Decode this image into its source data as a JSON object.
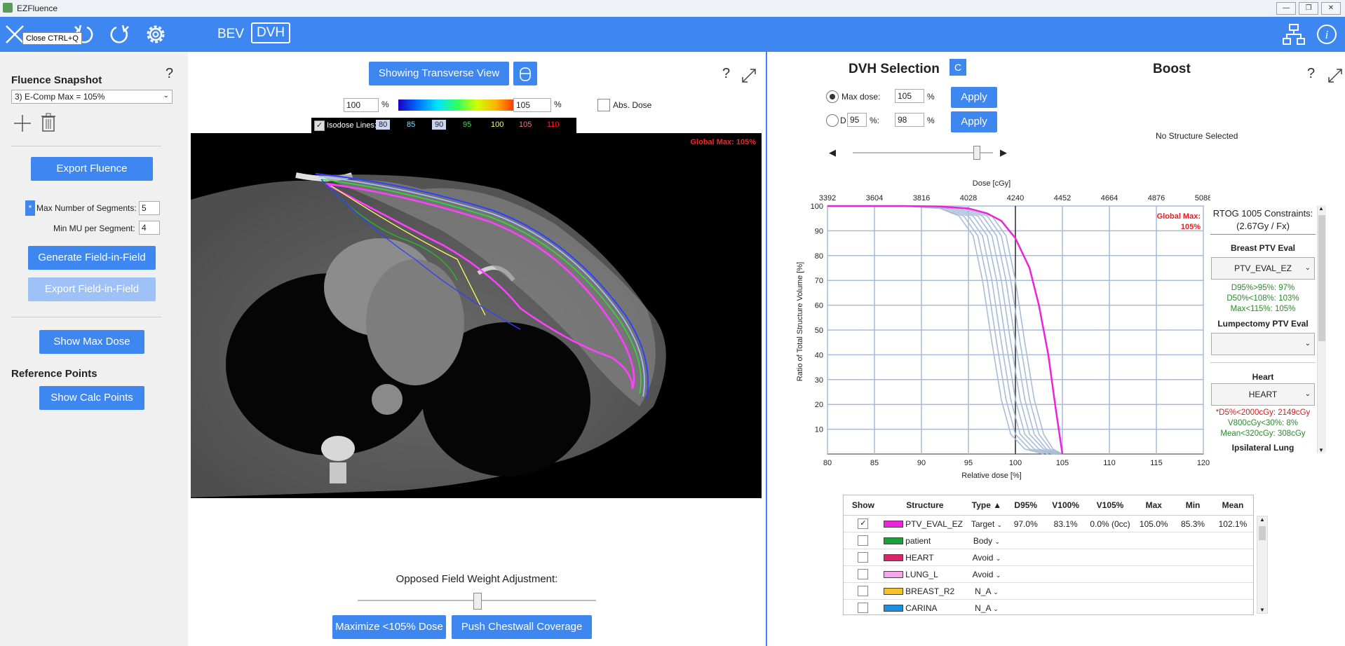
{
  "window": {
    "title": "EZFluence",
    "min": "—",
    "max": "❐",
    "close": "✕"
  },
  "toolbar": {
    "tooltip": "Close CTRL+Q",
    "bev": "BEV",
    "dvh": "DVH"
  },
  "left": {
    "snapshot_title": "Fluence Snapshot",
    "help": "?",
    "snapshot_selected": "3) E-Comp Max = 105%",
    "export_fluence": "Export Fluence",
    "asterisk": "*",
    "max_segments_label": "Max Number of Segments:",
    "max_segments_value": "5",
    "min_mu_label": "Min MU per Segment:",
    "min_mu_value": "4",
    "generate_fif": "Generate Field-in-Field",
    "export_fif": "Export Field-in-Field",
    "show_max_dose": "Show Max Dose",
    "reference_points": "Reference Points",
    "show_calc_points": "Show Calc Points"
  },
  "center": {
    "view_button": "Showing Transverse View",
    "help": "?",
    "range_min": "100",
    "range_max": "105",
    "pct": "%",
    "abs_dose": "Abs. Dose",
    "isodose_label": "Isodose Lines:",
    "isodose": [
      {
        "v": "80",
        "c": "#9db3e8"
      },
      {
        "v": "85",
        "c": "#7fe0ff"
      },
      {
        "v": "90",
        "c": "#9db3e8"
      },
      {
        "v": "95",
        "c": "#3ddc3d"
      },
      {
        "v": "100",
        "c": "#ffff66"
      },
      {
        "v": "105",
        "c": "#ff7070"
      },
      {
        "v": "110",
        "c": "#ff2020"
      }
    ],
    "global_max": "Global Max: 105%",
    "opposed_label": "Opposed Field Weight Adjustment:",
    "slider_value": 0.5,
    "maximize": "Maximize <105% Dose",
    "push": "Push Chestwall Coverage"
  },
  "right": {
    "dvh_title": "DVH Selection",
    "c_btn": "C",
    "boost_title": "Boost",
    "help": "?",
    "max_dose_label": "Max dose:",
    "max_dose_value": "105",
    "d_label": "D",
    "d_value": "95",
    "d_pct": "%:",
    "d_result": "98",
    "pct": "%",
    "apply": "Apply",
    "no_structure": "No Structure Selected",
    "arrow_left": "◀",
    "arrow_right": "▶",
    "dvh_slider": 0.88
  },
  "chart_data": {
    "type": "line",
    "title": "",
    "xlabel": "Relative dose [%]",
    "ylabel": "Ratio of Total Structure Volume [%]",
    "x2label": "Dose [cGy]",
    "xlim": [
      80,
      120
    ],
    "ylim": [
      0,
      100
    ],
    "x_ticks": [
      "80",
      "85",
      "90",
      "95",
      "100",
      "105",
      "110",
      "115",
      "120"
    ],
    "y_ticks": [
      "10",
      "20",
      "30",
      "40",
      "50",
      "60",
      "70",
      "80",
      "90",
      "100"
    ],
    "x2_ticks": [
      "3392",
      "3604",
      "3816",
      "4028",
      "4240",
      "4452",
      "4664",
      "4876",
      "5088"
    ],
    "ref_line_x": 100,
    "annotation": "Global Max: 105%",
    "series": [
      {
        "color": "#ee22dd",
        "x": [
          80,
          88,
          92,
          95,
          97,
          98.5,
          100,
          101.5,
          102.5,
          103.5,
          104.3,
          105
        ],
        "y": [
          100,
          100,
          99.8,
          99,
          97,
          94,
          87,
          75,
          60,
          40,
          18,
          0
        ]
      },
      {
        "color": "#a8bcd6",
        "x": [
          80,
          88,
          92,
          94,
          95.5,
          96.5,
          97.5,
          98.5,
          99.5,
          101,
          103
        ],
        "y": [
          100,
          100,
          99,
          96,
          88,
          70,
          45,
          22,
          8,
          2,
          0
        ]
      },
      {
        "color": "#a8bcd6",
        "x": [
          80,
          88,
          92,
          94.5,
          96,
          97,
          98,
          99,
          100,
          101.5,
          103.5
        ],
        "y": [
          100,
          100,
          99,
          96,
          88,
          70,
          45,
          22,
          8,
          2,
          0
        ]
      },
      {
        "color": "#a8bcd6",
        "x": [
          80,
          88,
          92.5,
          95,
          96.5,
          97.5,
          98.5,
          99.5,
          100.5,
          102,
          104
        ],
        "y": [
          100,
          100,
          99,
          96,
          88,
          70,
          45,
          22,
          8,
          2,
          0
        ]
      },
      {
        "color": "#a8bcd6",
        "x": [
          80,
          88,
          93,
          95.5,
          97,
          98,
          99,
          100,
          101,
          102.5,
          104.2
        ],
        "y": [
          100,
          100,
          99,
          96,
          88,
          70,
          45,
          22,
          8,
          2,
          0
        ]
      },
      {
        "color": "#a8bcd6",
        "x": [
          80,
          89,
          93.5,
          96,
          97.5,
          98.5,
          99.5,
          100.5,
          101.5,
          103,
          104.4
        ],
        "y": [
          100,
          100,
          99,
          96,
          88,
          70,
          45,
          22,
          8,
          2,
          0
        ]
      },
      {
        "color": "#a8bcd6",
        "x": [
          80,
          89,
          94,
          96.5,
          98,
          99,
          100,
          101,
          102,
          103.3,
          104.6
        ],
        "y": [
          100,
          100,
          99,
          96,
          88,
          70,
          45,
          22,
          8,
          2,
          0
        ]
      },
      {
        "color": "#a8bcd6",
        "x": [
          80,
          89,
          94.5,
          97,
          98.5,
          99.5,
          100.5,
          101.5,
          102.5,
          103.7,
          104.8
        ],
        "y": [
          100,
          100,
          99,
          96,
          88,
          70,
          45,
          22,
          8,
          2,
          0
        ]
      },
      {
        "color": "#a8bcd6",
        "x": [
          80,
          90,
          95,
          97.5,
          99,
          100,
          101,
          102,
          103,
          104,
          105
        ],
        "y": [
          100,
          100,
          99,
          96,
          88,
          70,
          45,
          22,
          8,
          2,
          0
        ]
      }
    ]
  },
  "constraints": {
    "title1": "RTOG 1005 Constraints:",
    "title2": "(2.67Gy / Fx)",
    "breast_title": "Breast PTV Eval",
    "breast_sel": "PTV_EVAL_EZ",
    "breast_lines": [
      {
        "t": "D95%>95%:  97%",
        "c": "#2a8a2a"
      },
      {
        "t": "D50%<108%:  103%",
        "c": "#2a8a2a"
      },
      {
        "t": "Max<115%:  105%",
        "c": "#2a8a2a"
      }
    ],
    "lump_title": "Lumpectomy PTV Eval",
    "heart_title": "Heart",
    "heart_sel": "HEART",
    "heart_lines": [
      {
        "t": "*D5%<2000cGy:  2149cGy",
        "c": "#d0201a"
      },
      {
        "t": "V800cGy<30%:  8%",
        "c": "#2a8a2a"
      },
      {
        "t": "Mean<320cGy:  308cGy",
        "c": "#2a8a2a"
      }
    ],
    "lung_title": "Ipsilateral Lung"
  },
  "table": {
    "headers": [
      "Show",
      "Structure",
      "Type ▲",
      "D95%",
      "V100%",
      "V105%",
      "Max",
      "Min",
      "Mean"
    ],
    "rows": [
      {
        "checked": "✓",
        "color": "#ee22dd",
        "name": "PTV_EVAL_EZ",
        "type": "Target",
        "d95": "97.0%",
        "v100": "83.1%",
        "v105": "0.0% (0cc)",
        "max": "105.0%",
        "min": "85.3%",
        "mean": "102.1%"
      },
      {
        "checked": "",
        "color": "#1aa03a",
        "name": "patient",
        "type": "Body",
        "d95": "",
        "v100": "",
        "v105": "",
        "max": "",
        "min": "",
        "mean": ""
      },
      {
        "checked": "",
        "color": "#e0206a",
        "name": "HEART",
        "type": "Avoid",
        "d95": "",
        "v100": "",
        "v105": "",
        "max": "",
        "min": "",
        "mean": ""
      },
      {
        "checked": "",
        "color": "#f6a6ea",
        "name": "LUNG_L",
        "type": "Avoid",
        "d95": "",
        "v100": "",
        "v105": "",
        "max": "",
        "min": "",
        "mean": ""
      },
      {
        "checked": "",
        "color": "#f7c227",
        "name": "BREAST_R2",
        "type": "N_A",
        "d95": "",
        "v100": "",
        "v105": "",
        "max": "",
        "min": "",
        "mean": ""
      },
      {
        "checked": "",
        "color": "#1a8fe0",
        "name": "CARINA",
        "type": "N_A",
        "d95": "",
        "v100": "",
        "v105": "",
        "max": "",
        "min": "",
        "mean": ""
      }
    ]
  }
}
